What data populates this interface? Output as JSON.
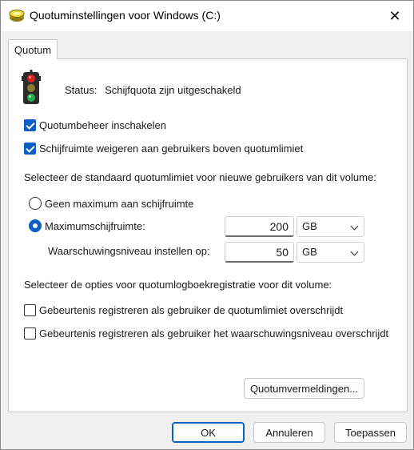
{
  "window": {
    "title": "Quotuminstellingen voor Windows (C:)",
    "close_glyph": "✕"
  },
  "tabs": [
    {
      "label": "Quotum"
    }
  ],
  "status": {
    "label": "Status:",
    "value": "Schijfquota zijn uitgeschakeld"
  },
  "options": {
    "enable_quota": {
      "label": "Quotumbeheer inschakelen",
      "checked": true
    },
    "deny_space": {
      "label": "Schijfruimte weigeren aan gebruikers boven quotumlimiet",
      "checked": true
    }
  },
  "default_limit": {
    "heading": "Selecteer de standaard quotumlimiet voor nieuwe gebruikers van dit volume:",
    "no_limit": {
      "label": "Geen maximum aan schijfruimte",
      "selected": false
    },
    "limit": {
      "label": "Maximumschijfruimte:",
      "selected": true,
      "value": "200",
      "unit": "GB"
    },
    "warning": {
      "label": "Waarschuwingsniveau instellen op:",
      "value": "50",
      "unit": "GB"
    }
  },
  "logging": {
    "heading": "Selecteer de opties voor quotumlogboekregistratie voor dit volume:",
    "log_limit": {
      "label": "Gebeurtenis registreren als gebruiker de quotumlimiet overschrijdt",
      "checked": false
    },
    "log_warning": {
      "label": "Gebeurtenis registreren als gebruiker het waarschuwingsniveau overschrijdt",
      "checked": false
    }
  },
  "buttons": {
    "entries": "Quotumvermeldingen...",
    "ok": "OK",
    "cancel": "Annuleren",
    "apply": "Toepassen"
  },
  "colors": {
    "accent": "#0a5ec4",
    "light_red": "#e02020",
    "light_yellow": "#e8c020",
    "light_green": "#22b14c"
  },
  "icons": {
    "title": "disk-drive-icon",
    "status": "traffic-light-icon"
  }
}
